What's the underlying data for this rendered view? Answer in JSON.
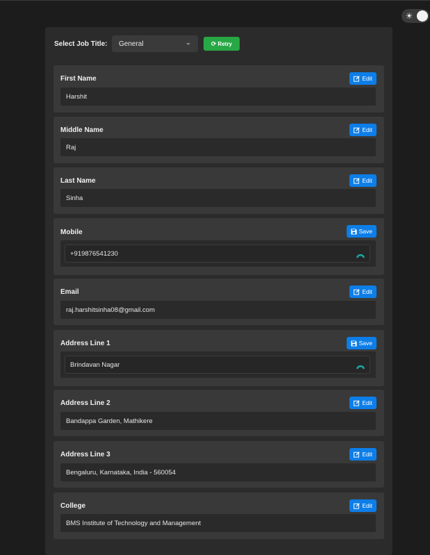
{
  "theme_toggle": {
    "icon": "sun-icon",
    "state": "dark"
  },
  "job": {
    "label": "Select Job Title:",
    "selected": "General",
    "retry_label": "Retry"
  },
  "colors": {
    "accent": "#0d7ee8",
    "success": "#28a745",
    "spinner": "#1aa5a0"
  },
  "fields": [
    {
      "label": "First Name",
      "value": "Harshit",
      "button": "Edit",
      "mode": "view"
    },
    {
      "label": "Middle Name",
      "value": "Raj",
      "button": "Edit",
      "mode": "view"
    },
    {
      "label": "Last Name",
      "value": "Sinha",
      "button": "Edit",
      "mode": "view"
    },
    {
      "label": "Mobile",
      "value": "+919876541230",
      "button": "Save",
      "mode": "edit"
    },
    {
      "label": "Email",
      "value": "raj.harshitsinha08@gmail.com",
      "button": "Edit",
      "mode": "view"
    },
    {
      "label": "Address Line 1",
      "value": "Brindavan Nagar",
      "button": "Save",
      "mode": "edit"
    },
    {
      "label": "Address Line 2",
      "value": "Bandappa Garden, Mathikere",
      "button": "Edit",
      "mode": "view"
    },
    {
      "label": "Address Line 3",
      "value": "Bengaluru, Karnataka, India - 560054",
      "button": "Edit",
      "mode": "view"
    },
    {
      "label": "College",
      "value": "BMS Institute of Technology and Management",
      "button": "Edit",
      "mode": "view"
    }
  ]
}
